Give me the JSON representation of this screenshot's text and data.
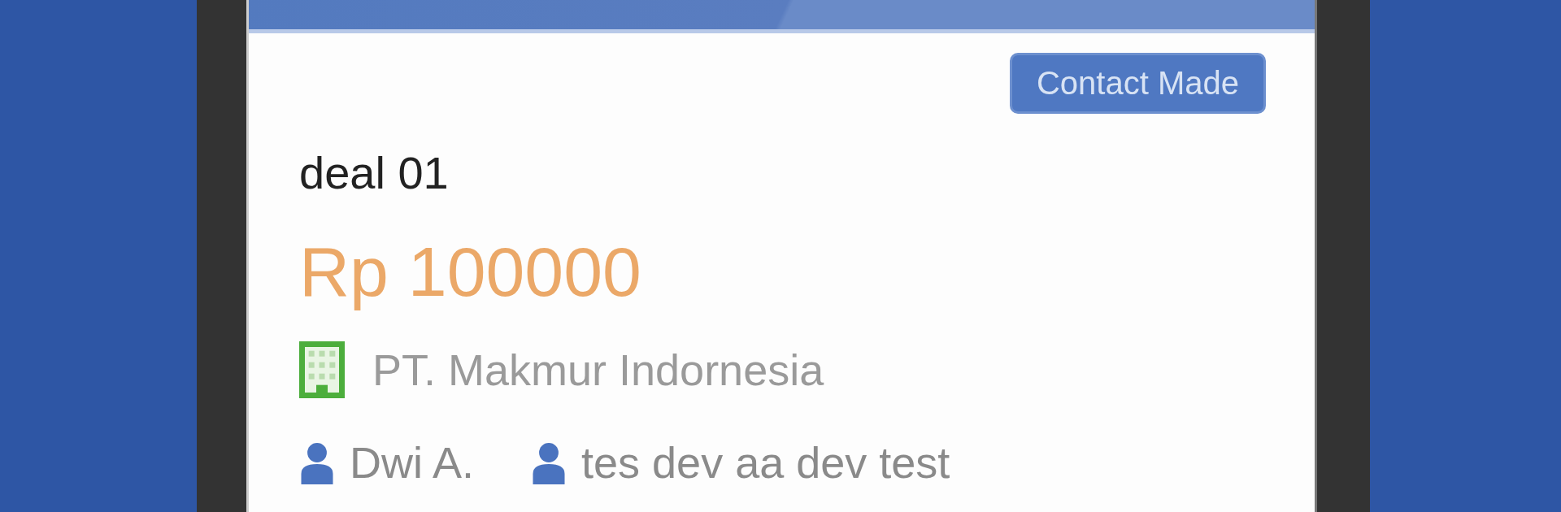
{
  "deal": {
    "stage": "Contact Made",
    "title": "deal 01",
    "amount": "Rp 100000",
    "company": "PT. Makmur Indornesia",
    "people": [
      {
        "name": "Dwi A."
      },
      {
        "name": "tes dev aa dev test"
      }
    ]
  }
}
